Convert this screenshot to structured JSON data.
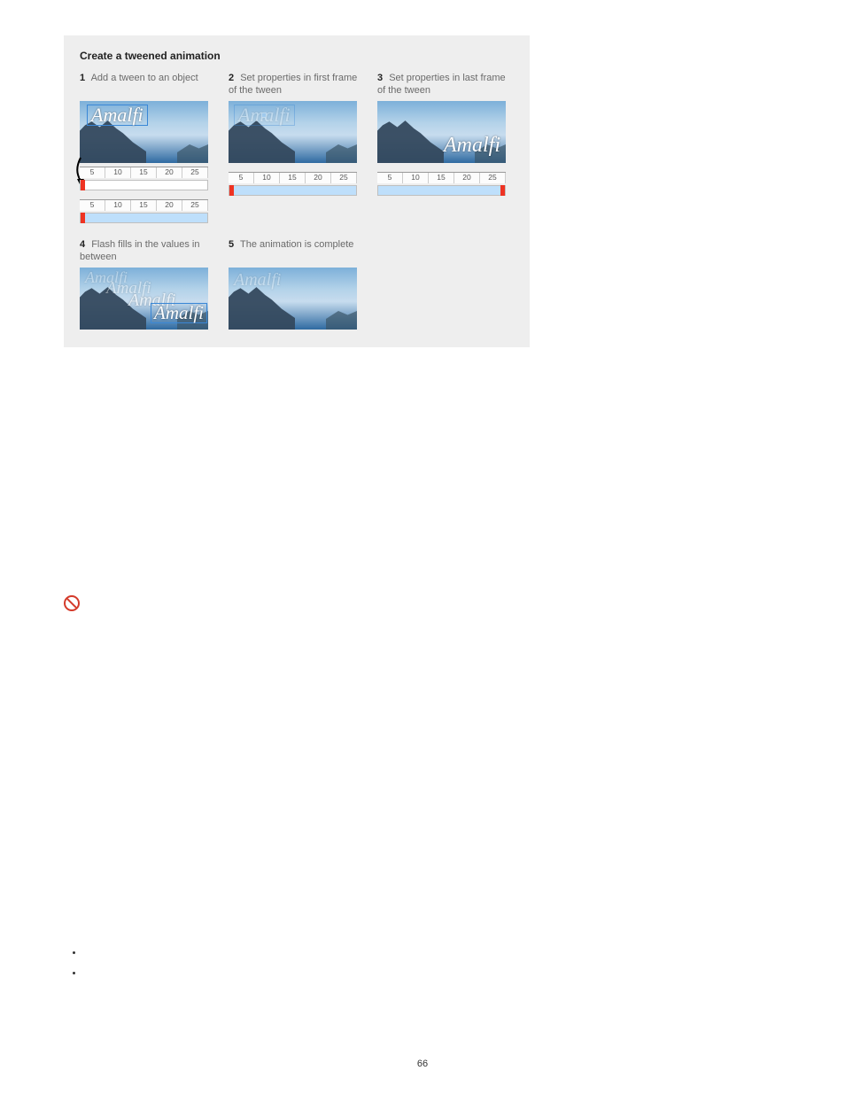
{
  "figure": {
    "title": "Create a tweened animation",
    "steps": [
      {
        "num": "1",
        "text": "Add a tween to an object"
      },
      {
        "num": "2",
        "text": "Set properties in first frame of the tween"
      },
      {
        "num": "3",
        "text": "Set properties in last frame of the tween"
      },
      {
        "num": "4",
        "text": "Flash fills in the values in between"
      },
      {
        "num": "5",
        "text": "The animation is complete"
      }
    ],
    "amalfi_label": "Amalfi",
    "ruler_ticks": [
      "5",
      "10",
      "15",
      "20",
      "25"
    ]
  },
  "page_number": "66"
}
